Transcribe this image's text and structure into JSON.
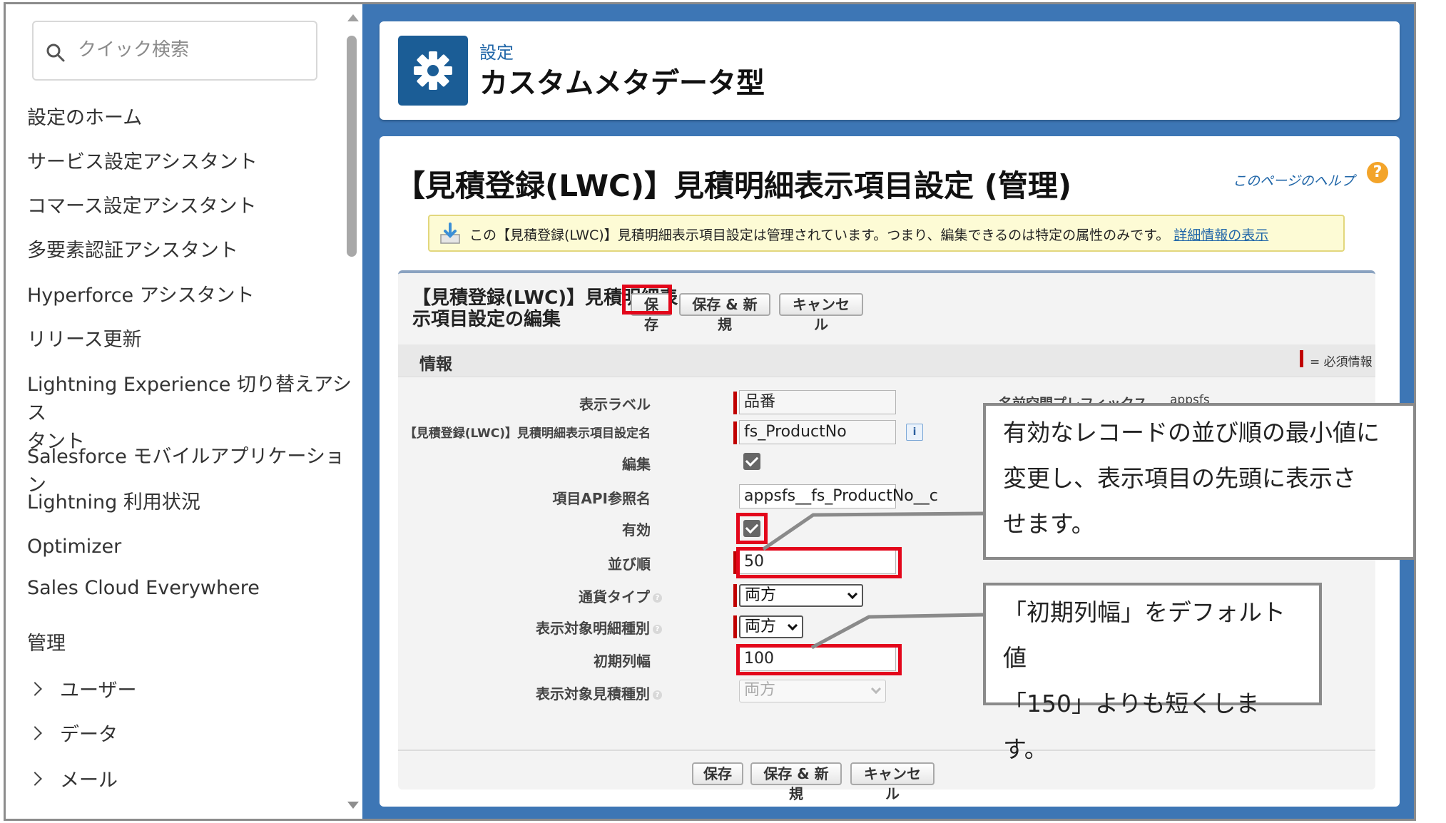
{
  "sidebar": {
    "search_placeholder": "クイック検索",
    "items": [
      "設定のホーム",
      "サービス設定アシスタント",
      "コマース設定アシスタント",
      "多要素認証アシスタント",
      "Hyperforce アシスタント",
      "リリース更新",
      "Lightning Experience 切り替えアシス",
      "タント",
      "Salesforce モバイルアプリケーション",
      "Lightning 利用状況",
      "Optimizer",
      "Sales Cloud Everywhere"
    ],
    "section": "管理",
    "groups": [
      "ユーザー",
      "データ",
      "メール"
    ]
  },
  "header": {
    "subtitle": "設定",
    "title": "カスタムメタデータ型"
  },
  "content": {
    "page_title": "【見積登録(LWC)】見積明細表示項目設定 (管理)",
    "help_link": "このページのヘルプ",
    "help_icon": "?",
    "notice": {
      "text": "この【見積登録(LWC)】見積明細表示項目設定は管理されています。つまり、編集できるのは特定の属性のみです。",
      "link": "詳細情報の表示"
    },
    "edit": {
      "title": "【見積登録(LWC)】見積明細表示項目設定の編集",
      "buttons": {
        "save": "保存",
        "save_new": "保存 & 新規",
        "cancel": "キャンセル"
      },
      "section_title": "情報",
      "required_legend": "= 必須情報",
      "fields": {
        "label": {
          "label": "表示ラベル",
          "value": "品番"
        },
        "name": {
          "label": "【見積登録(LWC)】見積明細表示項目設定名",
          "value": "fs_ProductNo"
        },
        "edit": {
          "label": "編集",
          "checked": true
        },
        "api_ref": {
          "label": "項目API参照名",
          "value": "appsfs__fs_ProductNo__c"
        },
        "active": {
          "label": "有効",
          "checked": true
        },
        "order": {
          "label": "並び順",
          "value": "50"
        },
        "currency_type": {
          "label": "通貨タイプ",
          "value": "両方"
        },
        "line_type": {
          "label": "表示対象明細種別",
          "value": "両方"
        },
        "initial_width": {
          "label": "初期列幅",
          "value": "100"
        },
        "quote_type": {
          "label": "表示対象見積種別",
          "value": "両方"
        }
      },
      "namespace": {
        "label": "名前空間プレフィックス",
        "value": "appsfs"
      },
      "info_button": "i"
    }
  },
  "callouts": {
    "top": [
      "有効なレコードの並び順の最小値に",
      "変更し、表示項目の先頭に表示さ",
      "せます。"
    ],
    "bottom": [
      "「初期列幅」をデフォルト値",
      "「150」よりも短くします。"
    ]
  },
  "colors": {
    "main_bg": "#3d76b5",
    "gear_tile": "#1b5d96",
    "highlight": "#e3061b",
    "notice_bg": "#fdfbd5",
    "required": "#c00000"
  }
}
